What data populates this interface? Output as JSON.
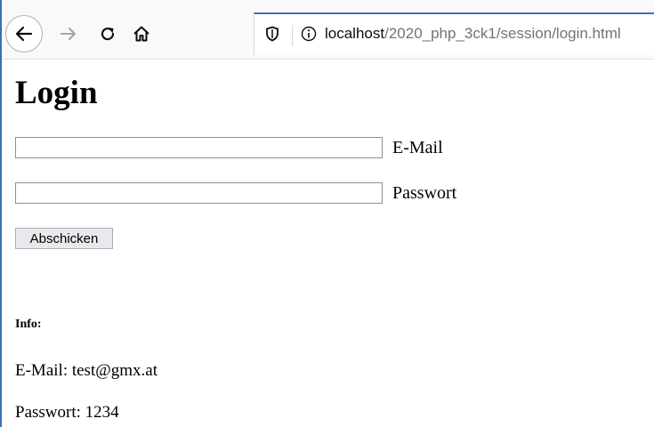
{
  "browser": {
    "url_host": "localhost",
    "url_path": "/2020_php_3ck1/session/login.html",
    "icons": [
      "back-arrow-icon",
      "forward-arrow-icon",
      "reload-icon",
      "home-icon",
      "shield-icon",
      "info-icon"
    ],
    "accent_color": "#3d6fb4"
  },
  "page": {
    "title": "Login",
    "form": {
      "email_value": "",
      "email_label": "E-Mail",
      "password_value": "",
      "password_label": "Passwort",
      "submit_label": "Abschicken"
    },
    "info": {
      "heading": "Info:",
      "email_line": "E-Mail: test@gmx.at",
      "password_line": "Passwort: 1234"
    }
  }
}
